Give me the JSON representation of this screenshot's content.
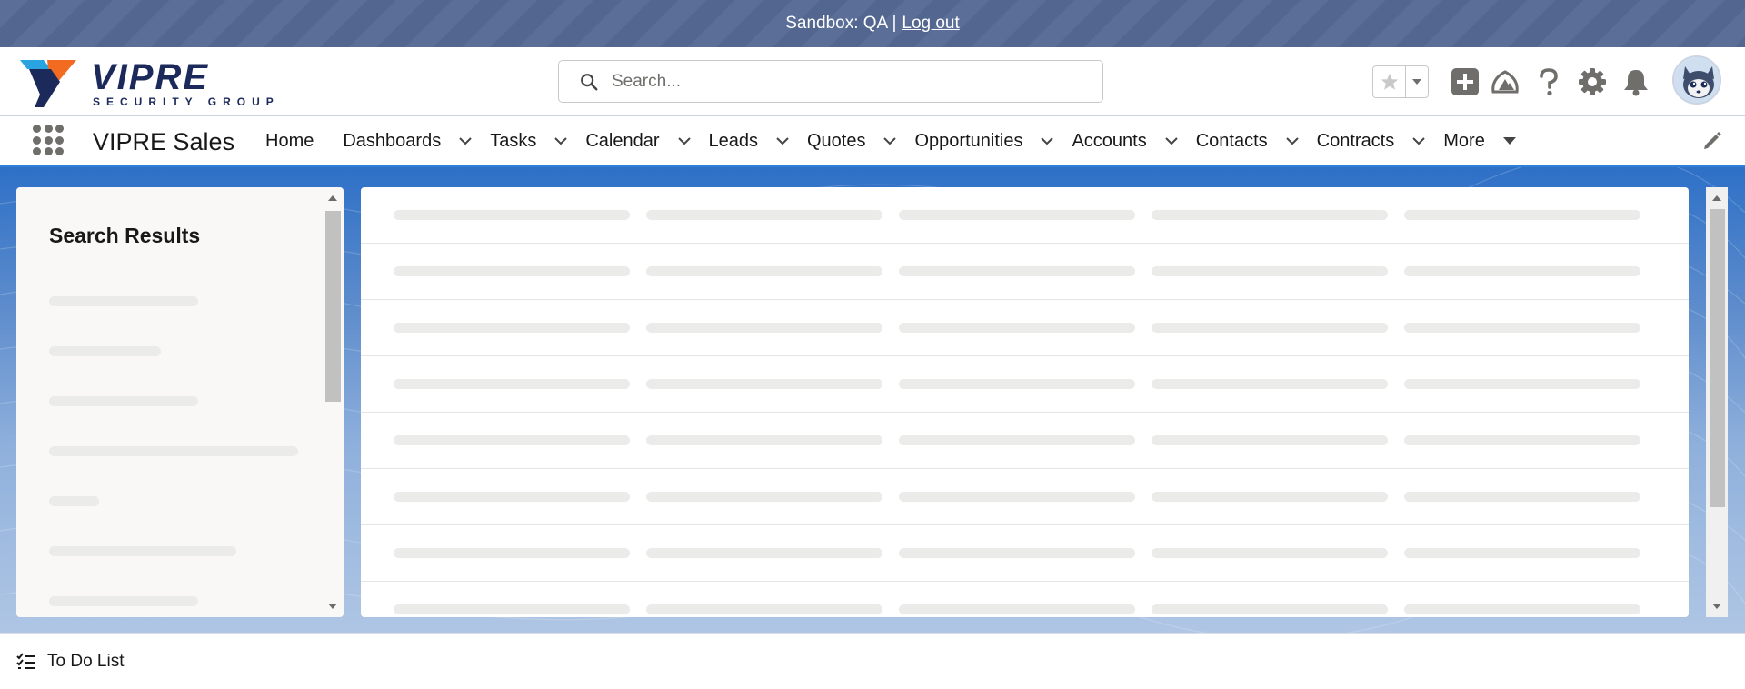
{
  "sandbox": {
    "label": "Sandbox: QA |",
    "logout": "Log out"
  },
  "header": {
    "logo": {
      "wordmark": "VIPRE",
      "tagline": "SECURITY GROUP"
    },
    "search": {
      "placeholder": "Search..."
    },
    "icons": [
      "favorite-star-icon",
      "favorites-caret-icon",
      "global-actions-plus-icon",
      "trailhead-icon",
      "help-icon",
      "setup-gear-icon",
      "notifications-bell-icon",
      "user-avatar"
    ]
  },
  "nav": {
    "app_name": "VIPRE Sales",
    "items": [
      {
        "label": "Home",
        "has_menu": false
      },
      {
        "label": "Dashboards",
        "has_menu": true
      },
      {
        "label": "Tasks",
        "has_menu": true
      },
      {
        "label": "Calendar",
        "has_menu": true
      },
      {
        "label": "Leads",
        "has_menu": true
      },
      {
        "label": "Quotes",
        "has_menu": true
      },
      {
        "label": "Opportunities",
        "has_menu": true
      },
      {
        "label": "Accounts",
        "has_menu": true
      },
      {
        "label": "Contacts",
        "has_menu": true
      },
      {
        "label": "Contracts",
        "has_menu": true
      },
      {
        "label": "More",
        "has_menu": true
      }
    ]
  },
  "left_panel": {
    "title": "Search Results",
    "loading_placeholders": 7
  },
  "right_panel": {
    "loading_rows": 8,
    "loading_columns": 5
  },
  "utility_bar": {
    "todo_label": "To Do List"
  },
  "colors": {
    "banner": "#5a6e98",
    "nav_accent": "#2f7fd4",
    "brand_navy": "#1b2a5a",
    "brand_orange": "#f26b21",
    "brand_blue": "#2aa4e0"
  }
}
